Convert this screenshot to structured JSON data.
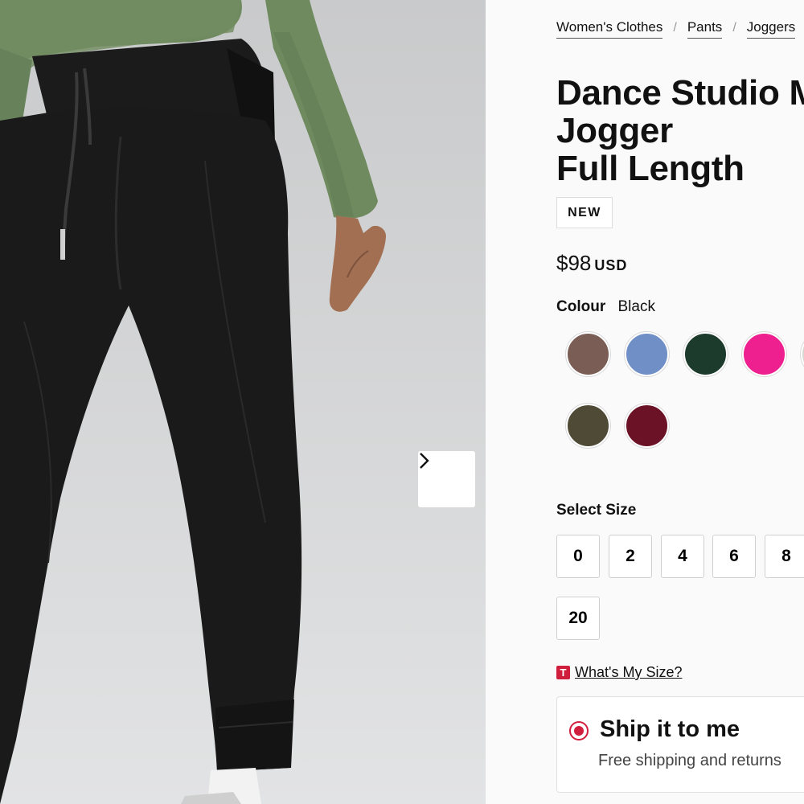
{
  "breadcrumb": [
    {
      "label": "Women's Clothes"
    },
    {
      "label": "Pants"
    },
    {
      "label": "Joggers"
    }
  ],
  "product": {
    "title_lines": [
      "Dance Studio Mid-Rise",
      "Jogger",
      "Full Length"
    ],
    "badge": "NEW",
    "price": "$98",
    "currency": "USD"
  },
  "colour": {
    "label": "Colour",
    "selected": "Black",
    "swatches": [
      {
        "color": "#7a5e56"
      },
      {
        "color": "#6f8fc6"
      },
      {
        "color": "#1d3b2c"
      },
      {
        "color": "#ee1f8e"
      },
      {
        "color": "#d8d6d2"
      },
      {
        "color": "#4e4a36"
      },
      {
        "color": "#6c1227"
      }
    ]
  },
  "size": {
    "label": "Select Size",
    "options": [
      "0",
      "2",
      "4",
      "6",
      "8",
      "20"
    ]
  },
  "size_help": {
    "icon_letter": "T",
    "link": "What's My Size?"
  },
  "shipping": {
    "title": "Ship it to me",
    "subtitle": "Free shipping and returns"
  },
  "colors": {
    "accent": "#d01f3c",
    "background": "#fafafa"
  }
}
